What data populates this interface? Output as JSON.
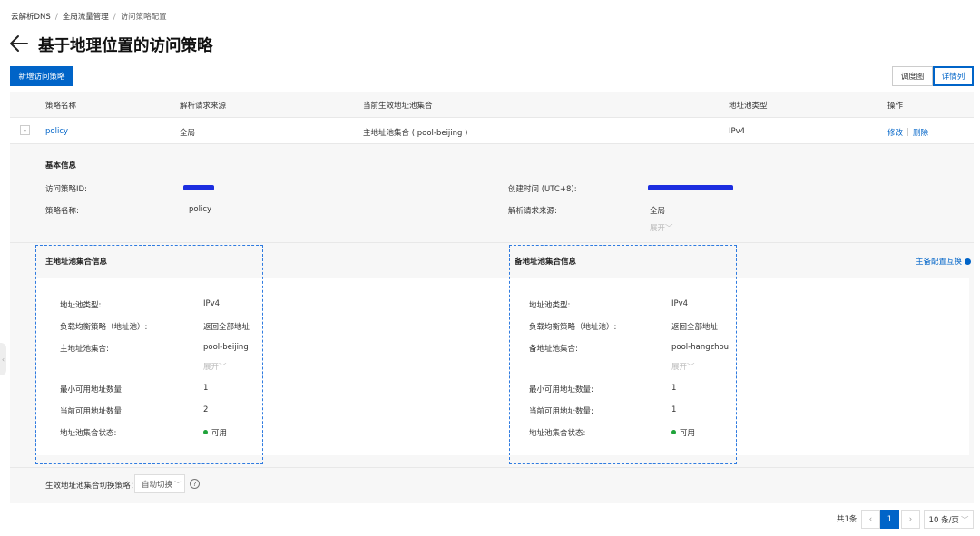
{
  "breadcrumb": {
    "items": [
      "云解析DNS",
      "全局流量管理",
      "访问策略配置"
    ],
    "sep": "/"
  },
  "page": {
    "title": "基于地理位置的访问策略"
  },
  "toolbar": {
    "add_label": "新增访问策略",
    "view_tab1": "调度图",
    "view_tab2": "详情列"
  },
  "table": {
    "headers": [
      "策略名称",
      "解析请求来源",
      "当前生效地址池集合",
      "地址池类型",
      "操作"
    ],
    "row": {
      "toggle": "-",
      "name": "policy",
      "source": "全局",
      "pool_set": "主地址池集合 ( pool-beijing )",
      "pool_type": "IPv4",
      "edit": "修改",
      "delete": "删除"
    }
  },
  "basic": {
    "title": "基本信息",
    "id_label": "访问策略ID:",
    "created_label": "创建时间 (UTC+8):",
    "name_label": "策略名称:",
    "name_value": "policy",
    "source_label": "解析请求来源:",
    "source_value": "全局",
    "expand": "展开"
  },
  "primary": {
    "title": "主地址池集合信息",
    "type_label": "地址池类型:",
    "type_value": "IPv4",
    "lb_label": "负载均衡策略（地址池）:",
    "lb_value": "返回全部地址",
    "set_label": "主地址池集合:",
    "set_value": "pool-beijing",
    "expand": "展开",
    "min_label": "最小可用地址数量:",
    "min_value": "1",
    "cur_label": "当前可用地址数量:",
    "cur_value": "2",
    "status_label": "地址池集合状态:",
    "status_value": "可用"
  },
  "backup": {
    "title": "备地址池集合信息",
    "type_label": "地址池类型:",
    "type_value": "IPv4",
    "lb_label": "负载均衡策略（地址池）:",
    "lb_value": "返回全部地址",
    "set_label": "备地址池集合:",
    "set_value": "pool-hangzhou",
    "expand": "展开",
    "min_label": "最小可用地址数量:",
    "min_value": "1",
    "cur_label": "当前可用地址数量:",
    "cur_value": "1",
    "status_label": "地址池集合状态:",
    "status_value": "可用"
  },
  "swap_label": "主备配置互换",
  "switch": {
    "label": "生效地址池集合切换策略：",
    "value": "自动切换",
    "help": "?"
  },
  "pagination": {
    "total": "共1条",
    "current": "1",
    "page_size": "10 条/页"
  },
  "colors": {
    "accent": "#0064c8",
    "available": "#1fa33a",
    "dashed_outline": "#2f7be0"
  }
}
